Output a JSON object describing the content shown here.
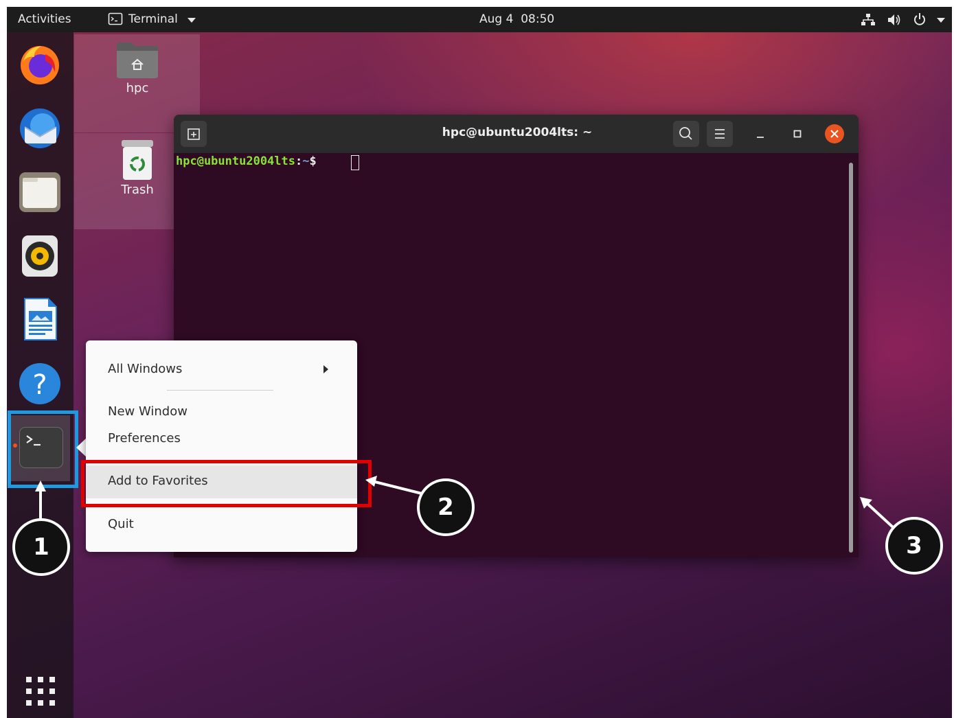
{
  "topbar": {
    "activities": "Activities",
    "app_menu": "Terminal",
    "clock": "Aug 4  08:50"
  },
  "desktop": {
    "home_label": "hpc",
    "trash_label": "Trash"
  },
  "terminal": {
    "title": "hpc@ubuntu2004lts: ~",
    "prompt_user": "hpc@ubuntu2004lts",
    "prompt_sep": ":",
    "prompt_path": "~",
    "prompt_symbol": "$"
  },
  "context_menu": {
    "items": [
      {
        "label": "All Windows"
      },
      {
        "label": "New Window"
      },
      {
        "label": "Preferences"
      },
      {
        "label": "Add to Favorites"
      },
      {
        "label": "Quit"
      }
    ]
  },
  "callouts": [
    "1",
    "2",
    "3"
  ],
  "colors": {
    "highlight_blue": "#1e9be0",
    "highlight_red": "#e10000",
    "terminal_bg": "#2e0a23",
    "prompt_green": "#8ae234",
    "close_orange": "#e95420"
  }
}
